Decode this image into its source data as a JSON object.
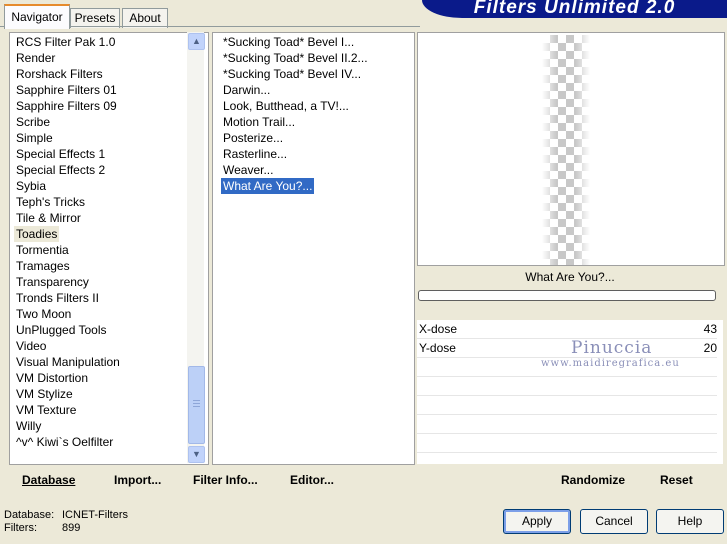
{
  "tabs": [
    "Navigator",
    "Presets",
    "About"
  ],
  "banner_title": "Filters Unlimited 2.0",
  "categories": [
    "RCS Filter Pak 1.0",
    "Render",
    "Rorshack Filters",
    "Sapphire Filters 01",
    "Sapphire Filters 09",
    "Scribe",
    "Simple",
    "Special Effects 1",
    "Special Effects 2",
    "Sybia",
    "Teph's Tricks",
    "Tile & Mirror",
    "Toadies",
    "Tormentia",
    "Tramages",
    "Transparency",
    "Tronds Filters II",
    "Two Moon",
    "UnPlugged Tools",
    "Video",
    "Visual Manipulation",
    "VM Distortion",
    "VM Stylize",
    "VM Texture",
    "Willy",
    "^v^ Kiwi`s Oelfilter"
  ],
  "selected_category": "Toadies",
  "filters": [
    "*Sucking Toad*  Bevel I...",
    "*Sucking Toad*  Bevel II.2...",
    "*Sucking Toad*  Bevel IV...",
    "Darwin...",
    "Look, Butthead, a TV!...",
    "Motion Trail...",
    "Posterize...",
    "Rasterline...",
    "Weaver...",
    "What Are You?..."
  ],
  "selected_filter": "What Are You?...",
  "preview_filter_name": "What Are You?...",
  "params": [
    {
      "label": "X-dose",
      "value": "43"
    },
    {
      "label": "Y-dose",
      "value": "20"
    }
  ],
  "watermark": "Pinuccia",
  "watermark_url": "www.maidiregrafica.eu",
  "bottom_links": {
    "database": "Database",
    "import": "Import...",
    "filter_info": "Filter Info...",
    "editor": "Editor...",
    "randomize": "Randomize",
    "reset": "Reset"
  },
  "status": {
    "database_label": "Database:",
    "database_value": "ICNET-Filters",
    "filters_label": "Filters:",
    "filters_value": "899"
  },
  "buttons": {
    "apply": "Apply",
    "cancel": "Cancel",
    "help": "Help"
  },
  "colors": {
    "selection": "#316ac5",
    "banner": "#0a1a8a",
    "tab_active_accent": "#e68b2c"
  }
}
